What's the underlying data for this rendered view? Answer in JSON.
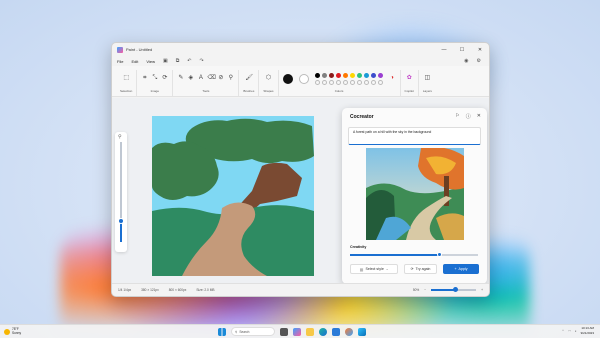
{
  "window": {
    "title": "Paint - Untitled",
    "controls": [
      "—",
      "☐",
      "✕"
    ]
  },
  "menu": [
    "File",
    "Edit",
    "View"
  ],
  "ribbon": {
    "groups": [
      "Selection",
      "Image",
      "Tools",
      "Brushes",
      "Shapes",
      "Colors",
      "Copilot",
      "Layers"
    ]
  },
  "palette": [
    "#000000",
    "#7f7f7f",
    "#8b1a1a",
    "#e01b24",
    "#ff7800",
    "#ffd700",
    "#2ec27e",
    "#1a9bd7",
    "#3d4dcc",
    "#9b3fd1"
  ],
  "zoom_slider": {
    "level_fraction": 0.22
  },
  "canvas": {
    "sky_color": "#7fd8f3",
    "tree_color": "#3b7d4b",
    "trunk_color": "#7a4a32",
    "grass_color": "#2e8b62",
    "path_color": "#c49a7a"
  },
  "cocreator": {
    "title": "Cocreator",
    "prompt": "A forest path on a hill with the sky in the background",
    "creativity_label": "Creativity",
    "creativity_level": 0.7,
    "select_style": "Select style",
    "try_again": "Try again",
    "apply": "Apply"
  },
  "status": {
    "position": "1/4 1/4px",
    "selection": "380 × 121px",
    "canvas_size": "800 × 600px",
    "file_size": "Size: 2.0 MB",
    "zoom": "50%"
  },
  "taskbar": {
    "weather_temp": "78°F",
    "weather_desc": "Sunny",
    "search_placeholder": "Search",
    "time": "10:13 AM",
    "date": "9/21/2023"
  }
}
